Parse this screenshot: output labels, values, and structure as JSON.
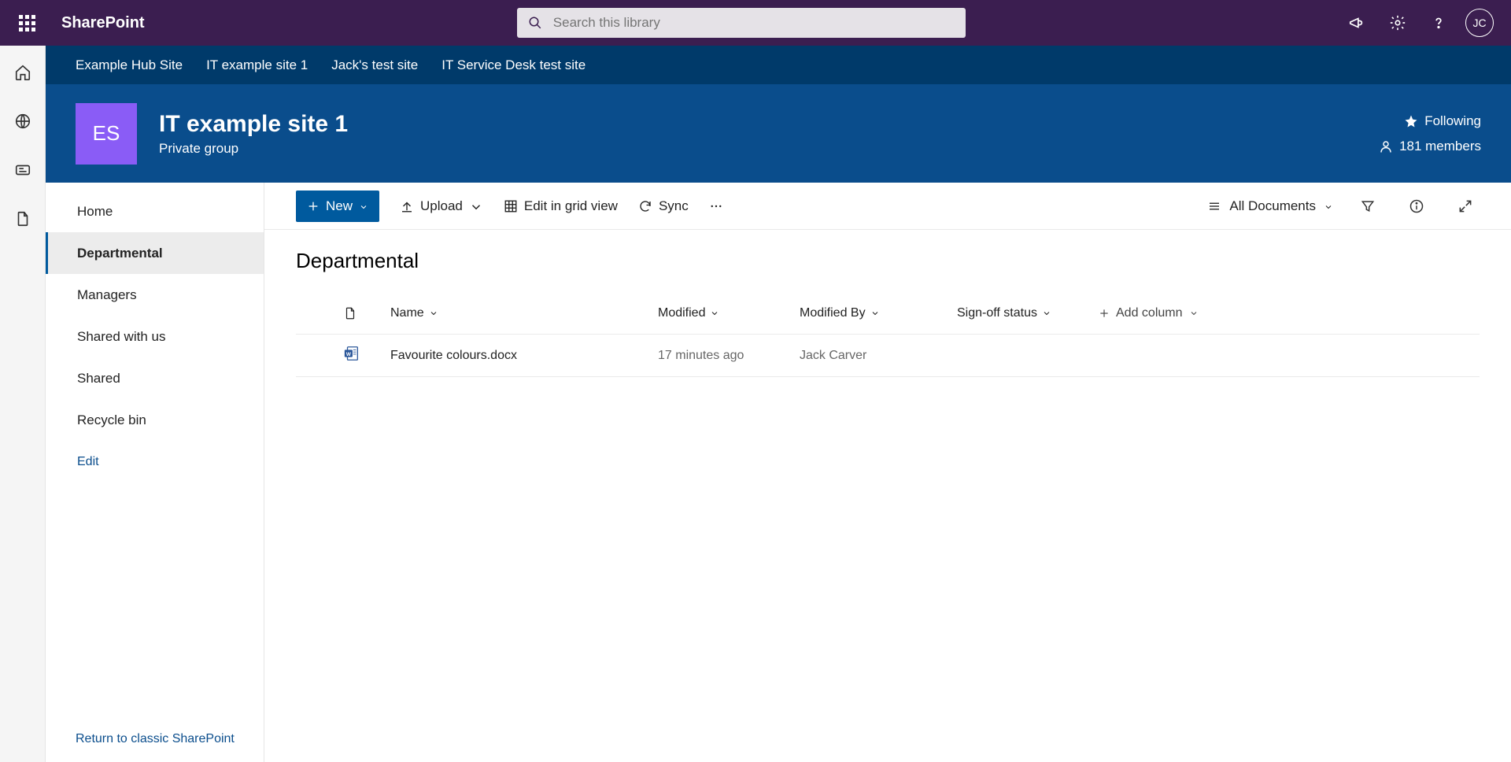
{
  "suite": {
    "app_name": "SharePoint",
    "search_placeholder": "Search this library",
    "avatar_initials": "JC"
  },
  "hub_nav": [
    "Example Hub Site",
    "IT example site 1",
    "Jack's test site",
    "IT Service Desk test site"
  ],
  "site": {
    "logo_initials": "ES",
    "title": "IT example site 1",
    "subtitle": "Private group",
    "following_label": "Following",
    "members_label": "181 members"
  },
  "left_nav": {
    "items": [
      "Home",
      "Departmental",
      "Managers",
      "Shared with us",
      "Shared",
      "Recycle bin"
    ],
    "selected_index": 1,
    "edit_label": "Edit",
    "classic_link": "Return to classic SharePoint"
  },
  "commands": {
    "new": "New",
    "upload": "Upload",
    "edit_grid": "Edit in grid view",
    "sync": "Sync",
    "view_label": "All Documents"
  },
  "library": {
    "title": "Departmental",
    "columns": {
      "name": "Name",
      "modified": "Modified",
      "modified_by": "Modified By",
      "signoff": "Sign-off status",
      "add_column": "Add column"
    },
    "rows": [
      {
        "name": "Favourite colours.docx",
        "modified": "17 minutes ago",
        "modified_by": "Jack Carver",
        "signoff": ""
      }
    ]
  }
}
